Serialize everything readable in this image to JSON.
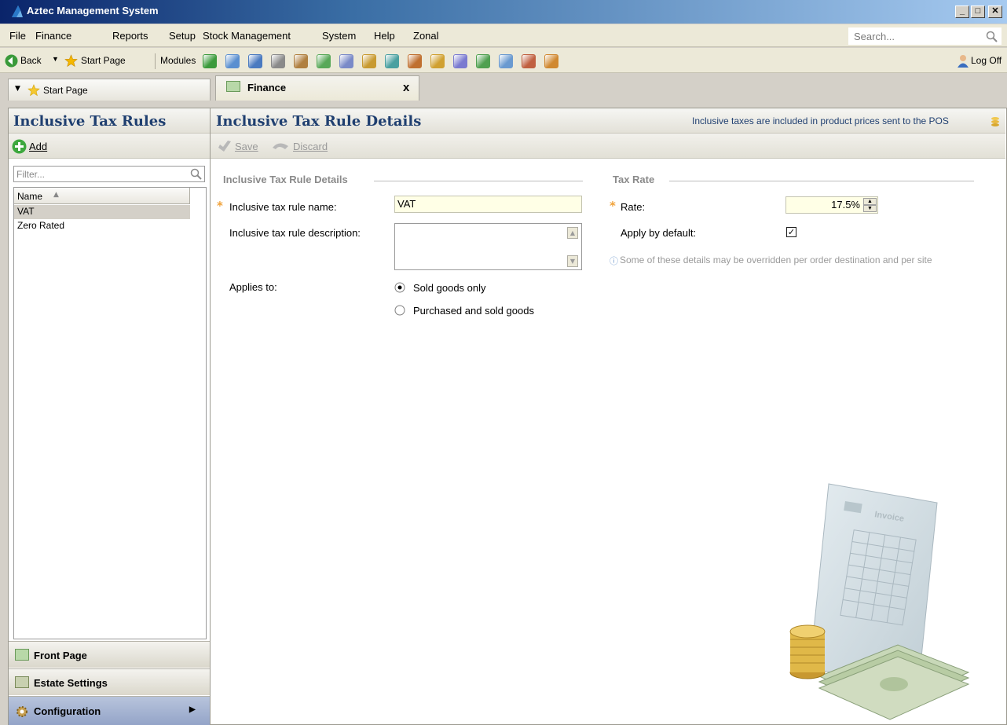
{
  "window": {
    "title": "Aztec Management System"
  },
  "menu": [
    "File",
    "Finance",
    "Reports",
    "Setup",
    "Stock Management",
    "System",
    "Help",
    "Zonal"
  ],
  "search": {
    "placeholder": "Search..."
  },
  "toolbar": {
    "back": "Back",
    "start_page": "Start Page",
    "modules": "Modules",
    "log_off": "Log Off"
  },
  "tabs": {
    "start": "Start Page",
    "finance": "Finance",
    "close": "x"
  },
  "left": {
    "title": "Inclusive Tax Rules",
    "add": "Add",
    "filter_placeholder": "Filter...",
    "column": "Name",
    "items": [
      "VAT",
      "Zero Rated"
    ],
    "nav": [
      "Front Page",
      "Estate Settings",
      "Configuration"
    ]
  },
  "right": {
    "title": "Inclusive Tax Rule Details",
    "info": "Inclusive taxes are included in product prices sent to the POS",
    "save": "Save",
    "discard": "Discard",
    "section_details": "Inclusive Tax Rule Details",
    "section_rate": "Tax Rate",
    "name_label": "Inclusive tax rule name:",
    "name_value": "VAT",
    "desc_label": "Inclusive tax rule description:",
    "desc_value": "",
    "applies_label": "Applies to:",
    "option_sold": "Sold goods only",
    "option_both": "Purchased and sold goods",
    "rate_label": "Rate:",
    "rate_value": "17.5%",
    "apply_default_label": "Apply by default:",
    "apply_default_checked": true,
    "note": "Some of these details may be overridden per order destination and per site",
    "invoice_text": "Invoice"
  },
  "colors": {
    "accent": "#1f3f70",
    "required": "#f0a23a",
    "input_bg": "#ffffe6"
  }
}
